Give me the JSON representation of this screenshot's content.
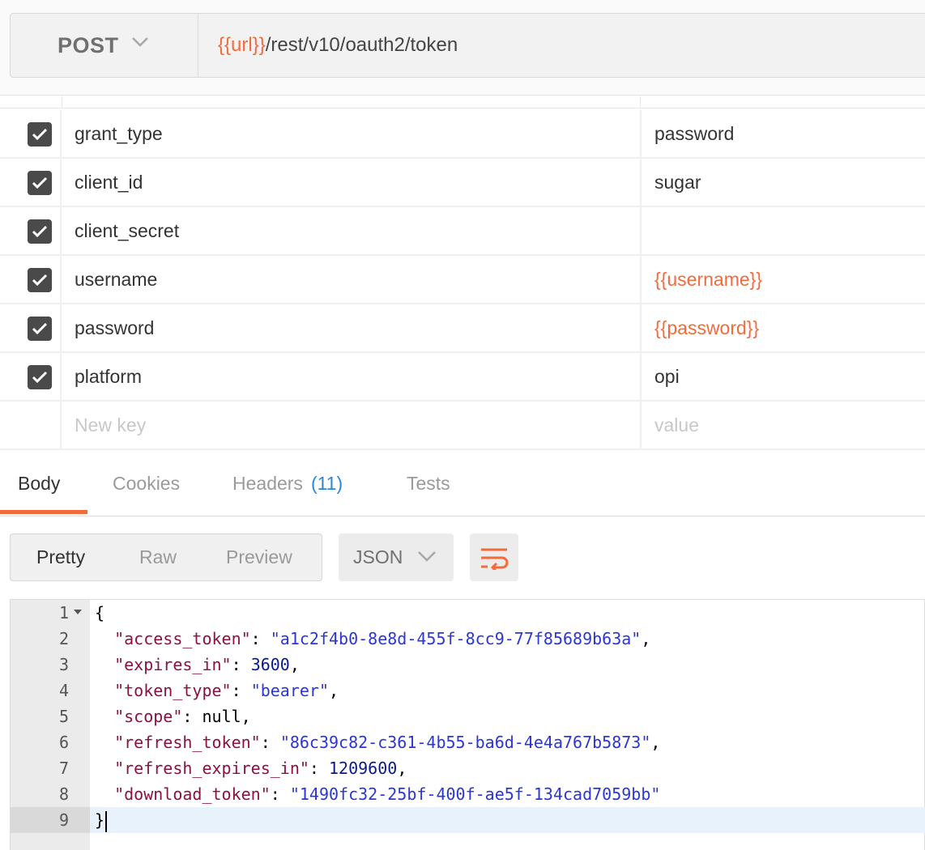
{
  "request": {
    "method": "POST",
    "url_var": "{{url}}",
    "url_path": "/rest/v10/oauth2/token"
  },
  "params": [
    {
      "key": "grant_type",
      "value": "password",
      "checked": true,
      "value_is_var": false
    },
    {
      "key": "client_id",
      "value": "sugar",
      "checked": true,
      "value_is_var": false
    },
    {
      "key": "client_secret",
      "value": "",
      "checked": true,
      "value_is_var": false
    },
    {
      "key": "username",
      "value": "{{username}}",
      "checked": true,
      "value_is_var": true
    },
    {
      "key": "password",
      "value": "{{password}}",
      "checked": true,
      "value_is_var": true
    },
    {
      "key": "platform",
      "value": "opi",
      "checked": true,
      "value_is_var": false
    }
  ],
  "new_param": {
    "key_placeholder": "New key",
    "value_placeholder": "value"
  },
  "response_tabs": {
    "body": "Body",
    "cookies": "Cookies",
    "headers": "Headers",
    "headers_count": "(11)",
    "tests": "Tests",
    "active": "Body"
  },
  "view_modes": {
    "pretty": "Pretty",
    "raw": "Raw",
    "preview": "Preview",
    "selected": "Pretty"
  },
  "format": "JSON",
  "colors": {
    "accent": "#f26b3a",
    "link": "#2a88d8",
    "json_key": "#8b1140",
    "json_string": "#2a36d6",
    "json_number": "#0a1a8c"
  },
  "code": {
    "lines": [
      "1",
      "2",
      "3",
      "4",
      "5",
      "6",
      "7",
      "8",
      "9"
    ],
    "open_brace": "{",
    "close_brace": "}",
    "entries": [
      {
        "key": "\"access_token\"",
        "value": "\"a1c2f4b0-8e8d-455f-8cc9-77f85689b63a\"",
        "type": "string",
        "trail": ","
      },
      {
        "key": "\"expires_in\"",
        "value": "3600",
        "type": "number",
        "trail": ","
      },
      {
        "key": "\"token_type\"",
        "value": "\"bearer\"",
        "type": "string",
        "trail": ","
      },
      {
        "key": "\"scope\"",
        "value": "null",
        "type": "null",
        "trail": ","
      },
      {
        "key": "\"refresh_token\"",
        "value": "\"86c39c82-c361-4b55-ba6d-4e4a767b5873\"",
        "type": "string",
        "trail": ","
      },
      {
        "key": "\"refresh_expires_in\"",
        "value": "1209600",
        "type": "number",
        "trail": ","
      },
      {
        "key": "\"download_token\"",
        "value": "\"1490fc32-25bf-400f-ae5f-134cad7059bb\"",
        "type": "string",
        "trail": ""
      }
    ]
  }
}
